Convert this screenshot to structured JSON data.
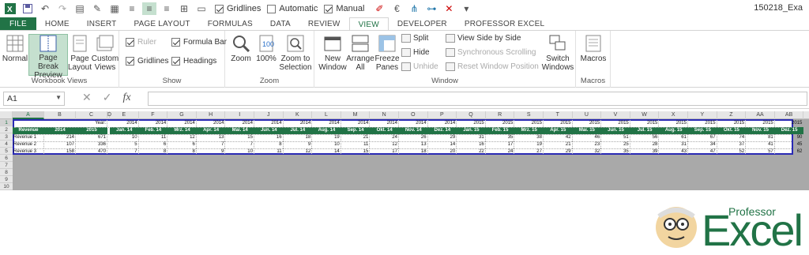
{
  "qat": {
    "gridlines_label": "Gridlines",
    "automatic_label": "Automatic",
    "manual_label": "Manual",
    "title": "150218_Exa"
  },
  "tabs": [
    "FILE",
    "HOME",
    "INSERT",
    "PAGE LAYOUT",
    "FORMULAS",
    "DATA",
    "REVIEW",
    "VIEW",
    "DEVELOPER",
    "PROFESSOR EXCEL"
  ],
  "ribbon": {
    "workbook_views": {
      "label": "Workbook Views",
      "normal": "Normal",
      "page_break": "Page Break Preview",
      "page_layout": "Page Layout",
      "custom_views": "Custom Views"
    },
    "show": {
      "label": "Show",
      "ruler": "Ruler",
      "formula_bar": "Formula Bar",
      "gridlines": "Gridlines",
      "headings": "Headings"
    },
    "zoom": {
      "label": "Zoom",
      "zoom": "Zoom",
      "zoom100": "100%",
      "zoom_selection": "Zoom to Selection"
    },
    "window": {
      "label": "Window",
      "new_window": "New Window",
      "arrange_all": "Arrange All",
      "freeze_panes": "Freeze Panes",
      "split": "Split",
      "hide": "Hide",
      "unhide": "Unhide",
      "side_by_side": "View Side by Side",
      "sync_scroll": "Synchronous Scrolling",
      "reset_pos": "Reset Window Position",
      "switch": "Switch Windows"
    },
    "macros": {
      "label": "Macros",
      "macros": "Macros"
    }
  },
  "formula_bar": {
    "name_box": "A1",
    "fx": "fx"
  },
  "columns": [
    "A",
    "B",
    "C",
    "D",
    "E",
    "F",
    "G",
    "H",
    "I",
    "J",
    "K",
    "L",
    "M",
    "N",
    "O",
    "P",
    "Q",
    "R",
    "S",
    "T",
    "U",
    "V",
    "W",
    "X",
    "Y",
    "Z",
    "AA",
    "AB"
  ],
  "rows": [
    "1",
    "2",
    "3",
    "4",
    "5",
    "6",
    "7",
    "8",
    "9",
    "10"
  ],
  "sheet": {
    "year_label": "Year:",
    "revenue_header": "Revenue",
    "y2014": "2014",
    "y2015": "2015",
    "year_row": [
      "2014",
      "2014",
      "2014",
      "2014",
      "2014",
      "2014",
      "2014",
      "2014",
      "2014",
      "2014",
      "2014",
      "2014",
      "2015",
      "2015",
      "2015",
      "2015",
      "2015",
      "2015",
      "2015",
      "2015",
      "2015",
      "2015",
      "2015",
      "2015"
    ],
    "months": [
      "Jan. 14",
      "Feb. 14",
      "Mrz. 14",
      "Apr. 14",
      "Mai. 14",
      "Jun. 14",
      "Jul. 14",
      "Aug. 14",
      "Sep. 14",
      "Okt. 14",
      "Nov. 14",
      "Dez. 14",
      "Jan. 15",
      "Feb. 15",
      "Mrz. 15",
      "Apr. 15",
      "Mai. 15",
      "Jun. 15",
      "Jul. 15",
      "Aug. 15",
      "Sep. 15",
      "Okt. 15",
      "Nov. 15",
      "Dez. 15"
    ],
    "rows": [
      {
        "label": "Revenue 1",
        "v2014": "214",
        "v2015": "671",
        "m": [
          "10",
          "11",
          "12",
          "13",
          "15",
          "16",
          "18",
          "19",
          "21",
          "24",
          "26",
          "29",
          "31",
          "35",
          "38",
          "42",
          "46",
          "51",
          "56",
          "61",
          "67",
          "74",
          "81",
          "90"
        ]
      },
      {
        "label": "Revenue 2",
        "v2014": "107",
        "v2015": "336",
        "m": [
          "5",
          "6",
          "6",
          "7",
          "7",
          "8",
          "9",
          "10",
          "11",
          "12",
          "13",
          "14",
          "16",
          "17",
          "19",
          "21",
          "23",
          "25",
          "28",
          "31",
          "34",
          "37",
          "41",
          "45"
        ]
      },
      {
        "label": "Revenue 3",
        "v2014": "158",
        "v2015": "470",
        "m": [
          "7",
          "8",
          "8",
          "9",
          "10",
          "11",
          "12",
          "14",
          "15",
          "17",
          "18",
          "20",
          "22",
          "24",
          "27",
          "29",
          "32",
          "35",
          "39",
          "43",
          "47",
          "52",
          "57",
          "62"
        ]
      }
    ]
  },
  "logo": {
    "professor": "Professor",
    "excel": "Excel"
  },
  "colors": {
    "accent": "#217346",
    "page_border": "#2a2ab4"
  }
}
